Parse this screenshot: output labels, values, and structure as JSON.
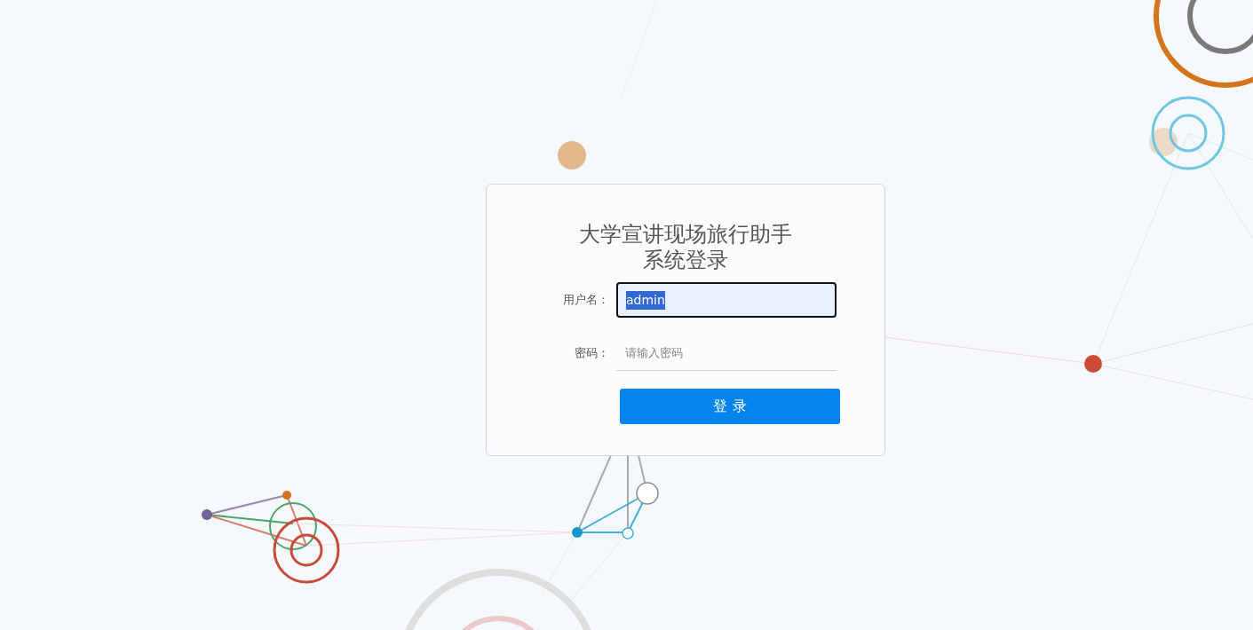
{
  "title": "大学宣讲现场旅行助手系统登录",
  "fields": [
    {
      "label": "用户名：",
      "value": "admin",
      "focused": true,
      "value_selected": true
    },
    {
      "label": "密码：",
      "placeholder": "请输入密码",
      "focused": false
    }
  ],
  "submit": "登 录"
}
